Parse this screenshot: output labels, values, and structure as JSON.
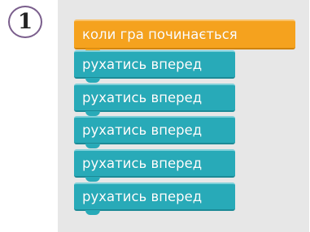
{
  "step": {
    "number": "1"
  },
  "script": {
    "event_block": {
      "label": "коли гра починається",
      "color": "#f5a21e"
    },
    "action_blocks": [
      {
        "label": "рухатись вперед",
        "color": "#28aab8"
      },
      {
        "label": "рухатись вперед",
        "color": "#28aab8"
      },
      {
        "label": "рухатись вперед",
        "color": "#28aab8"
      },
      {
        "label": "рухатись вперед",
        "color": "#28aab8"
      },
      {
        "label": "рухатись вперед",
        "color": "#28aab8"
      }
    ]
  }
}
